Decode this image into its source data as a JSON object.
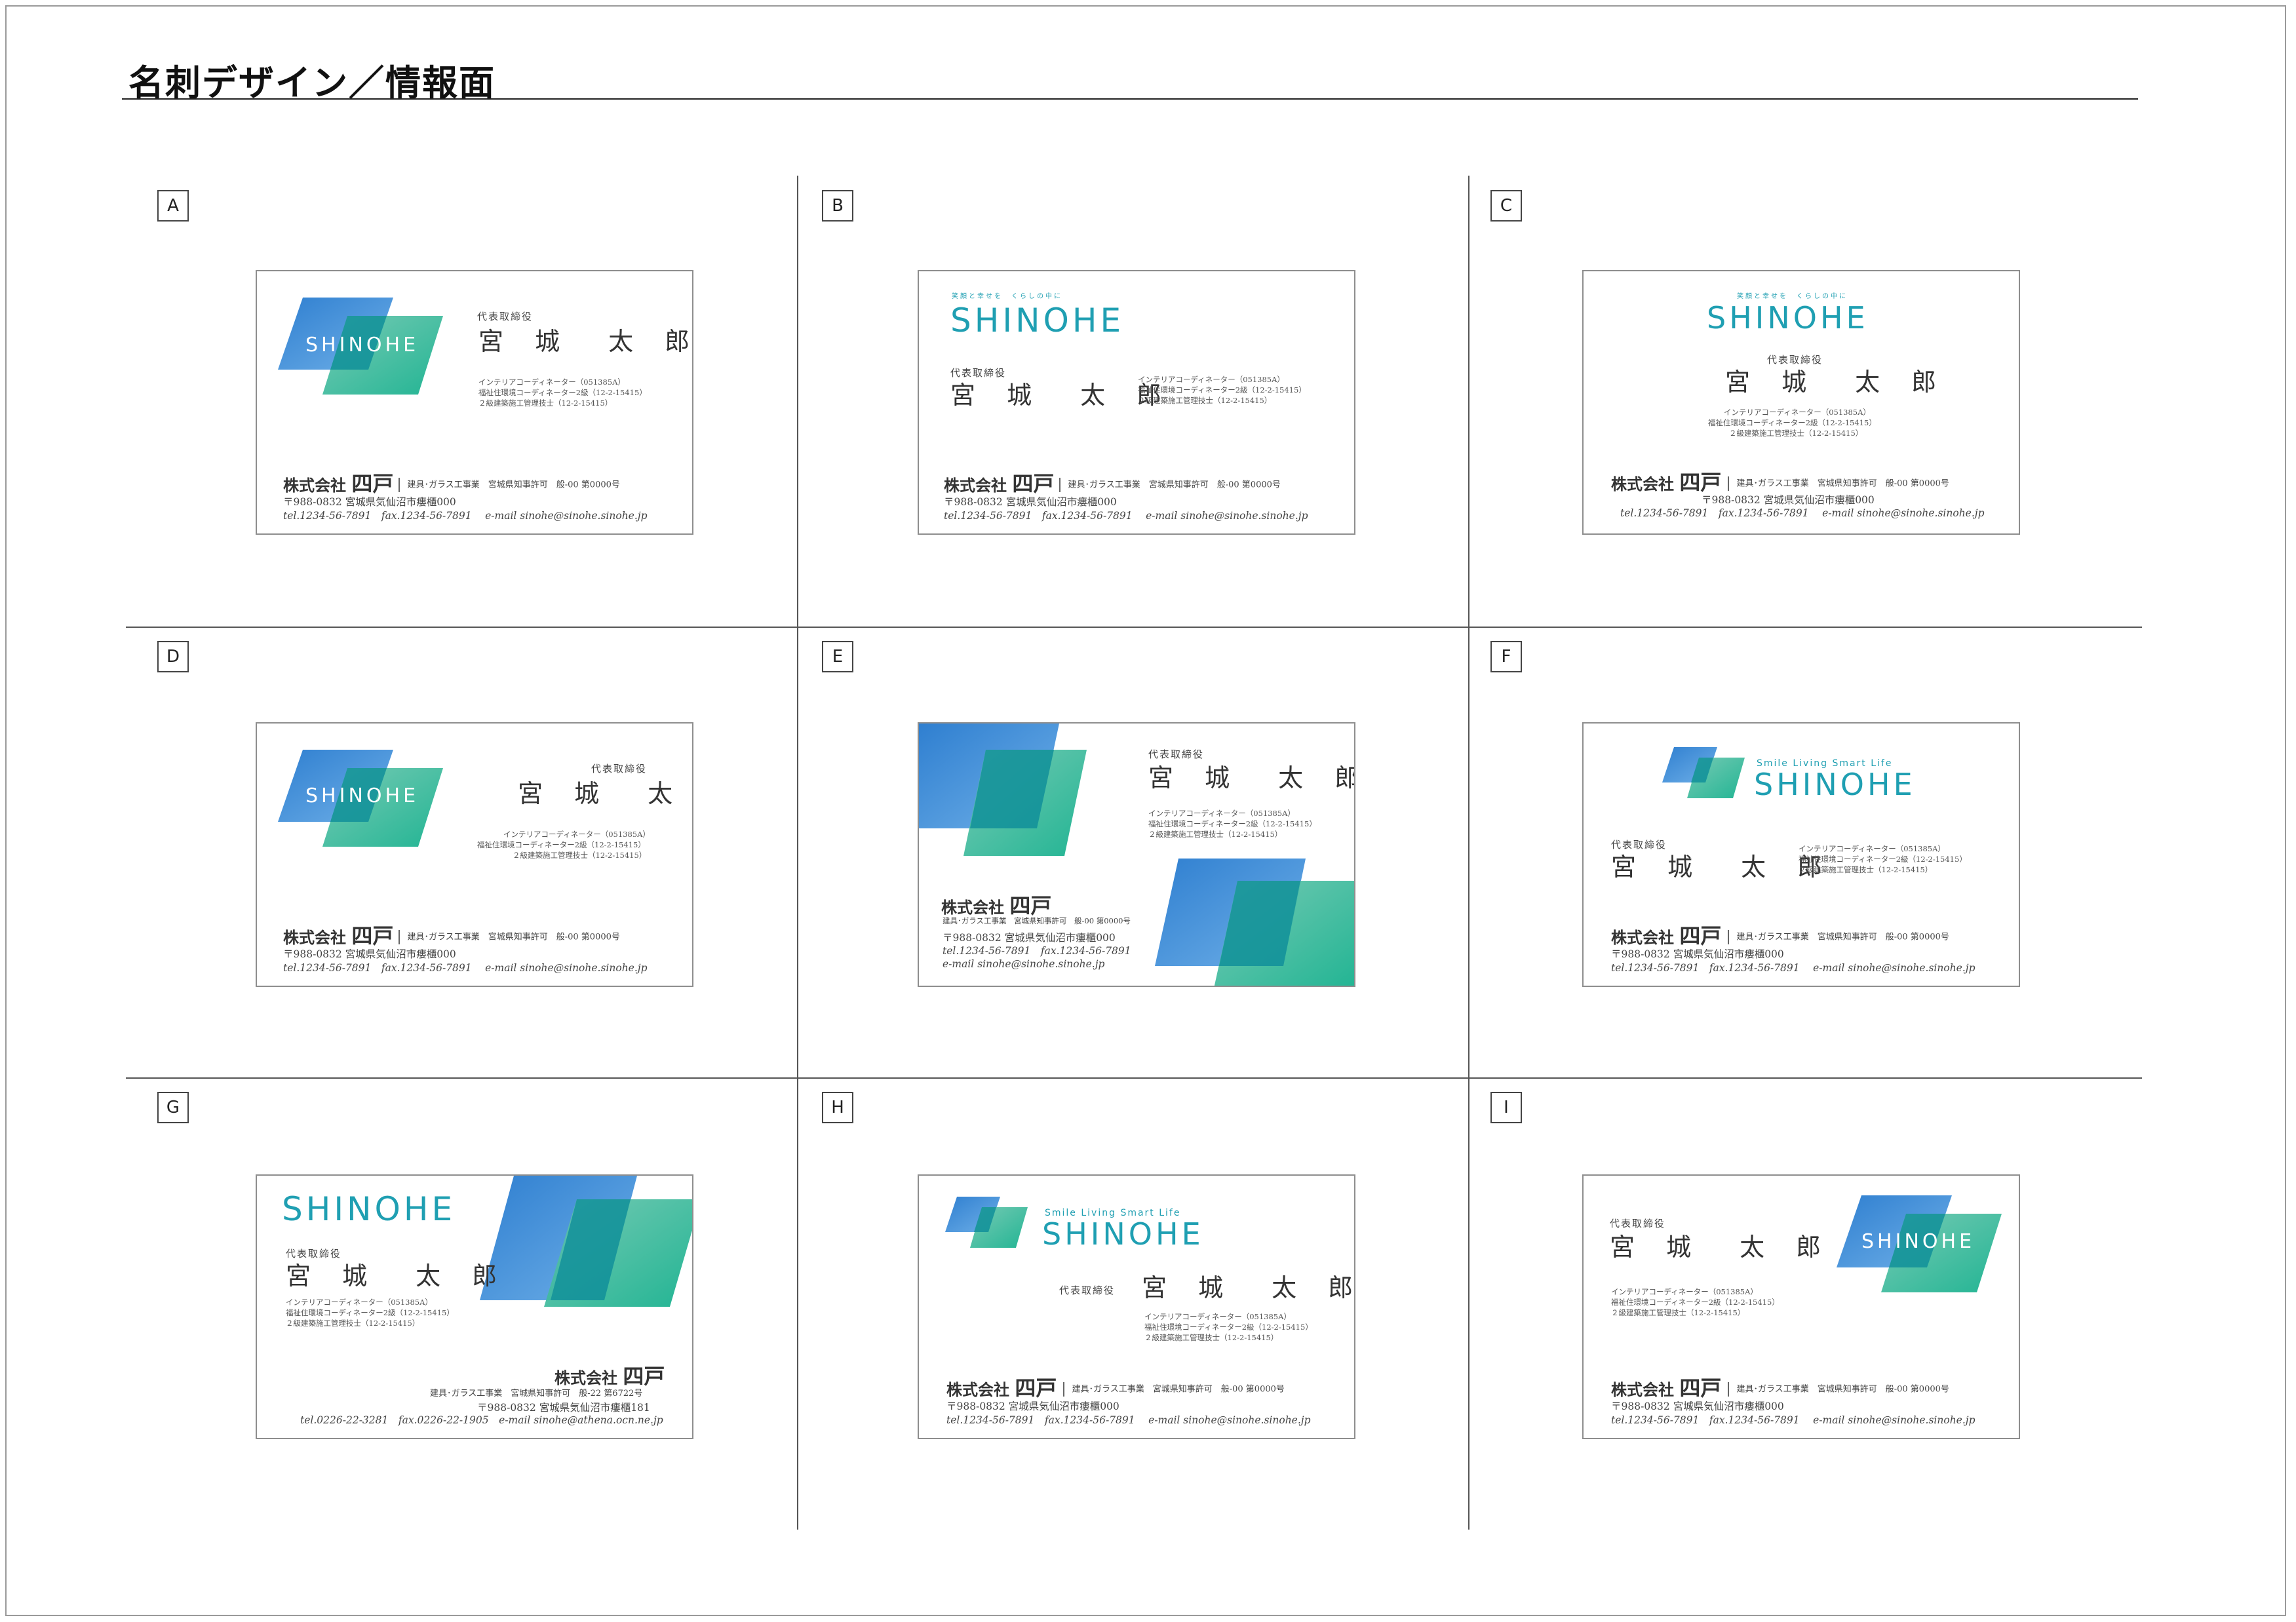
{
  "page": {
    "title": "名刺デザイン／情報面"
  },
  "colors": {
    "blue": "#3e8fd6",
    "green": "#1fb08e",
    "teal_text": "#1f9fb2",
    "overlap": "#148d92"
  },
  "common": {
    "logo": "SHINOHE",
    "tagline_jp": "笑顔と幸せを　くらしの中に",
    "tagline_en": "Smile Living Smart Life",
    "title": "代表取締役",
    "name": "宮 城　太 郎",
    "qual": [
      "インテリアコーディネーター（051385A）",
      "福祉住環境コーディネーター2級（12-2-15415）",
      "２級建築施工管理技士（12-2-15415）"
    ],
    "company_prefix": "株式会社",
    "company_name": "四戸",
    "business": "建具･ガラス工事業　宮城県知事許可　般-00 第0000号",
    "address": "〒988-0832 宮城県気仙沼市瘻櫃000",
    "tel": "tel.1234-56-7891",
    "fax": "fax.1234-56-7891",
    "email": "e-mail sinohe@sinohe.sinohe.jp"
  },
  "card_g": {
    "business": "建具･ガラス工事業　宮城県知事許可　般-22 第6722号",
    "address": "〒988-0832 宮城県気仙沼市瘻櫃181",
    "contact": "tel.0226-22-3281　fax.0226-22-1905　e-mail sinohe@athena.ocn.ne.jp"
  },
  "cells": [
    {
      "label": "A"
    },
    {
      "label": "B"
    },
    {
      "label": "C"
    },
    {
      "label": "D"
    },
    {
      "label": "E"
    },
    {
      "label": "F"
    },
    {
      "label": "G"
    },
    {
      "label": "H"
    },
    {
      "label": "I"
    }
  ]
}
